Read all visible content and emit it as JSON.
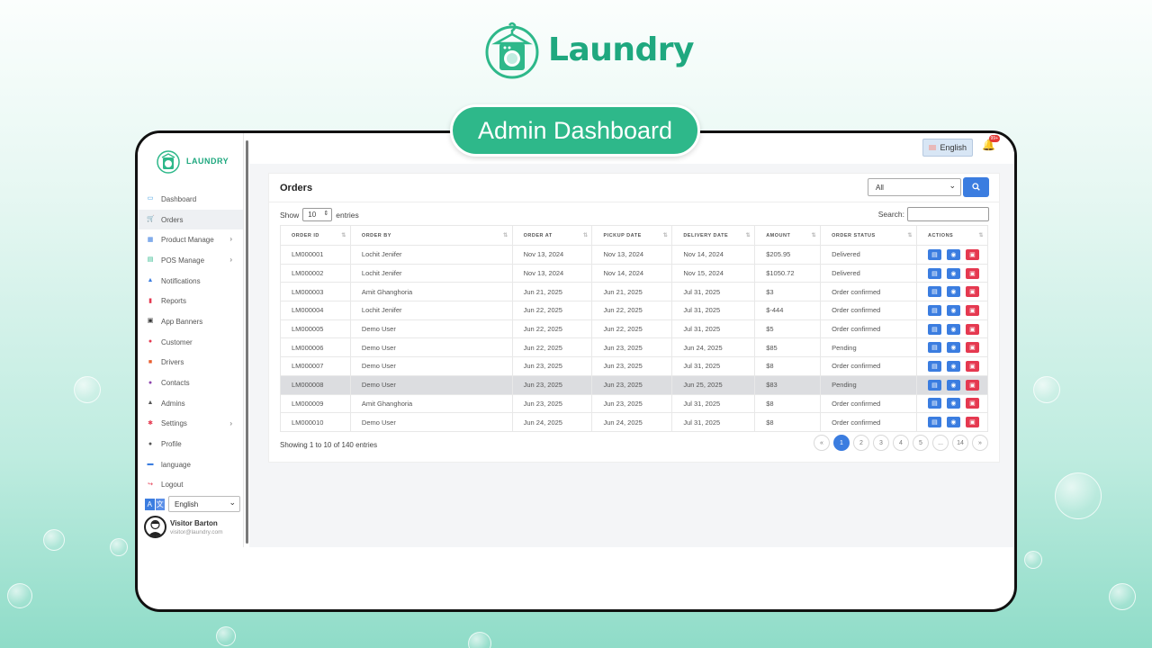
{
  "brand": {
    "name": "Laundry",
    "sidebar_name": "LAUNDRY",
    "color": "#1fa87f"
  },
  "banner": {
    "title": "Admin Dashboard"
  },
  "sidebar": {
    "items": [
      {
        "label": "Dashboard",
        "icon": "monitor-icon",
        "color": "#3b9be0"
      },
      {
        "label": "Orders",
        "icon": "cart-icon",
        "color": "#e85d2e",
        "active": true
      },
      {
        "label": "Product Manage",
        "icon": "grid-icon",
        "color": "#3b7de0",
        "submenu": true
      },
      {
        "label": "POS Manage",
        "icon": "pos-icon",
        "color": "#2eb88a",
        "submenu": true
      },
      {
        "label": "Notifications",
        "icon": "bell-icon",
        "color": "#3b7de0"
      },
      {
        "label": "Reports",
        "icon": "file-icon",
        "color": "#e53950"
      },
      {
        "label": "App Banners",
        "icon": "image-icon",
        "color": "#333333"
      },
      {
        "label": "Customer",
        "icon": "users-icon",
        "color": "#e53950"
      },
      {
        "label": "Drivers",
        "icon": "truck-icon",
        "color": "#e85d2e"
      },
      {
        "label": "Contacts",
        "icon": "chat-icon",
        "color": "#8e44ad"
      },
      {
        "label": "Admins",
        "icon": "admin-icon",
        "color": "#555555"
      },
      {
        "label": "Settings",
        "icon": "gear-icon",
        "color": "#e53950",
        "submenu": true
      },
      {
        "label": "Profile",
        "icon": "user-icon",
        "color": "#555555"
      },
      {
        "label": "language",
        "icon": "language-icon",
        "color": "#3b7de0"
      },
      {
        "label": "Logout",
        "icon": "logout-icon",
        "color": "#e53950"
      }
    ],
    "language_select": "English",
    "user": {
      "name": "Visitor Barton",
      "email": "visitor@laundry.com"
    }
  },
  "topbar": {
    "language": "English",
    "notification_count": "99+"
  },
  "orders": {
    "title": "Orders",
    "filter": "All",
    "show_label": "Show",
    "entries_value": "10",
    "entries_label": "entries",
    "search_label": "Search:",
    "columns": [
      "Order ID",
      "Order By",
      "Order At",
      "Pickup Date",
      "Delivery Date",
      "Amount",
      "Order Status",
      "Actions"
    ],
    "rows": [
      [
        "LM000001",
        "Lochit Jenifer",
        "Nov 13, 2024",
        "Nov 13, 2024",
        "Nov 14, 2024",
        "$205.95",
        "Delivered"
      ],
      [
        "LM000002",
        "Lochit Jenifer",
        "Nov 13, 2024",
        "Nov 14, 2024",
        "Nov 15, 2024",
        "$1050.72",
        "Delivered"
      ],
      [
        "LM000003",
        "Amit Ghanghoria",
        "Jun 21, 2025",
        "Jun 21, 2025",
        "Jul 31, 2025",
        "$3",
        "Order confirmed"
      ],
      [
        "LM000004",
        "Lochit Jenifer",
        "Jun 22, 2025",
        "Jun 22, 2025",
        "Jul 31, 2025",
        "$-444",
        "Order confirmed"
      ],
      [
        "LM000005",
        "Demo User",
        "Jun 22, 2025",
        "Jun 22, 2025",
        "Jul 31, 2025",
        "$5",
        "Order confirmed"
      ],
      [
        "LM000006",
        "Demo User",
        "Jun 22, 2025",
        "Jun 23, 2025",
        "Jun 24, 2025",
        "$85",
        "Pending"
      ],
      [
        "LM000007",
        "Demo User",
        "Jun 23, 2025",
        "Jun 23, 2025",
        "Jul 31, 2025",
        "$8",
        "Order confirmed"
      ],
      [
        "LM000008",
        "Demo User",
        "Jun 23, 2025",
        "Jun 23, 2025",
        "Jun 25, 2025",
        "$83",
        "Pending"
      ],
      [
        "LM000009",
        "Amit Ghanghoria",
        "Jun 23, 2025",
        "Jun 23, 2025",
        "Jul 31, 2025",
        "$8",
        "Order confirmed"
      ],
      [
        "LM000010",
        "Demo User",
        "Jun 24, 2025",
        "Jun 24, 2025",
        "Jul 31, 2025",
        "$8",
        "Order confirmed"
      ]
    ],
    "highlighted_row": 7,
    "info": "Showing 1 to 10 of 140 entries",
    "pagination": [
      "«",
      "1",
      "2",
      "3",
      "4",
      "5",
      "...",
      "14",
      "»"
    ],
    "current_page": "1"
  }
}
